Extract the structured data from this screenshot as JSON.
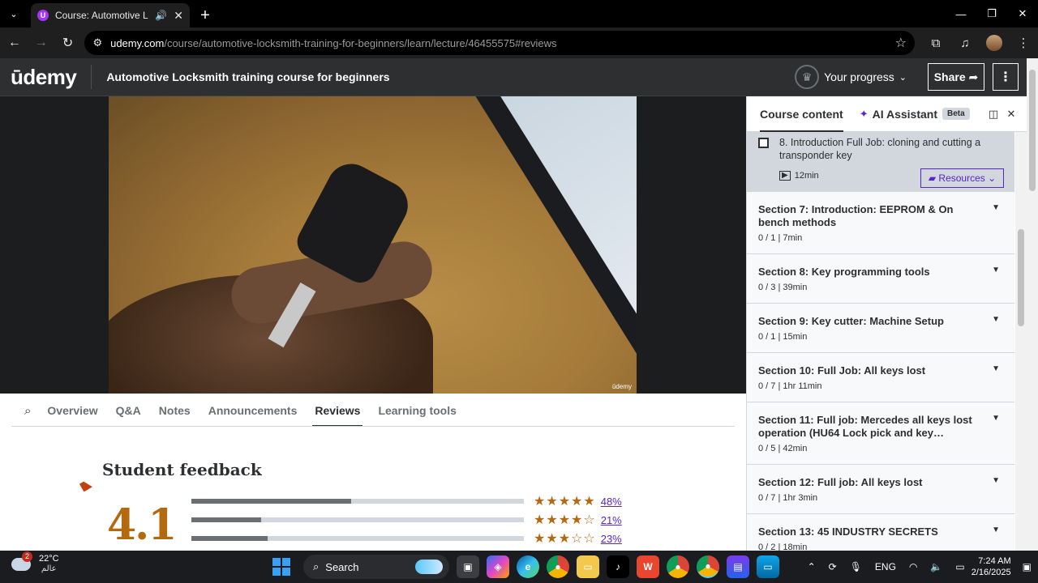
{
  "browser": {
    "tab_title": "Course: Automotive Locksmi",
    "url_host": "udemy.com",
    "url_path": "/course/automotive-locksmith-training-for-beginners/learn/lecture/46455575#reviews"
  },
  "header": {
    "logo": "ūdemy",
    "course_title": "Automotive Locksmith training course for beginners",
    "progress_label": "Your progress",
    "share_label": "Share"
  },
  "video": {
    "watermark": "ūdemy"
  },
  "tabs": [
    "Overview",
    "Q&A",
    "Notes",
    "Announcements",
    "Reviews",
    "Learning tools"
  ],
  "feedback": {
    "title": "Student feedback",
    "score": "4.1",
    "rows": [
      {
        "pct_label": "48%",
        "fill": 0.48,
        "stars": "★★★★★"
      },
      {
        "pct_label": "21%",
        "fill": 0.21,
        "stars": "★★★★☆"
      },
      {
        "pct_label": "23%",
        "fill": 0.23,
        "stars": "★★★☆☆"
      }
    ]
  },
  "sidebar": {
    "tab_course_content": "Course content",
    "tab_ai": "AI Assistant",
    "beta": "Beta",
    "lecture": {
      "title": "8. Introduction Full Job: cloning and cutting a transponder key",
      "duration": "12min",
      "resources_label": "Resources"
    },
    "sections": [
      {
        "title": "Section 7: Introduction: EEPROM & On bench methods",
        "meta": "0 / 1 | 7min"
      },
      {
        "title": "Section 8: Key programming tools",
        "meta": "0 / 3 | 39min"
      },
      {
        "title": "Section 9: Key cutter: Machine Setup",
        "meta": "0 / 1 | 15min"
      },
      {
        "title": "Section 10: Full Job: All keys lost",
        "meta": "0 / 7 | 1hr 11min"
      },
      {
        "title": "Section 11: Full job: Mercedes all keys lost operation (HU64 Lock pick and key…",
        "meta": "0 / 5 | 42min"
      },
      {
        "title": "Section 12: Full job: All keys lost",
        "meta": "0 / 7 | 1hr 3min"
      },
      {
        "title": "Section 13: 45 INDUSTRY SECRETS",
        "meta": "0 / 2 | 18min"
      }
    ]
  },
  "taskbar": {
    "weather_temp": "22°C",
    "weather_desc": "عالم",
    "weather_badge": "2",
    "search_label": "Search",
    "lang": "ENG",
    "time": "7:24 AM",
    "date": "2/16/2025"
  }
}
